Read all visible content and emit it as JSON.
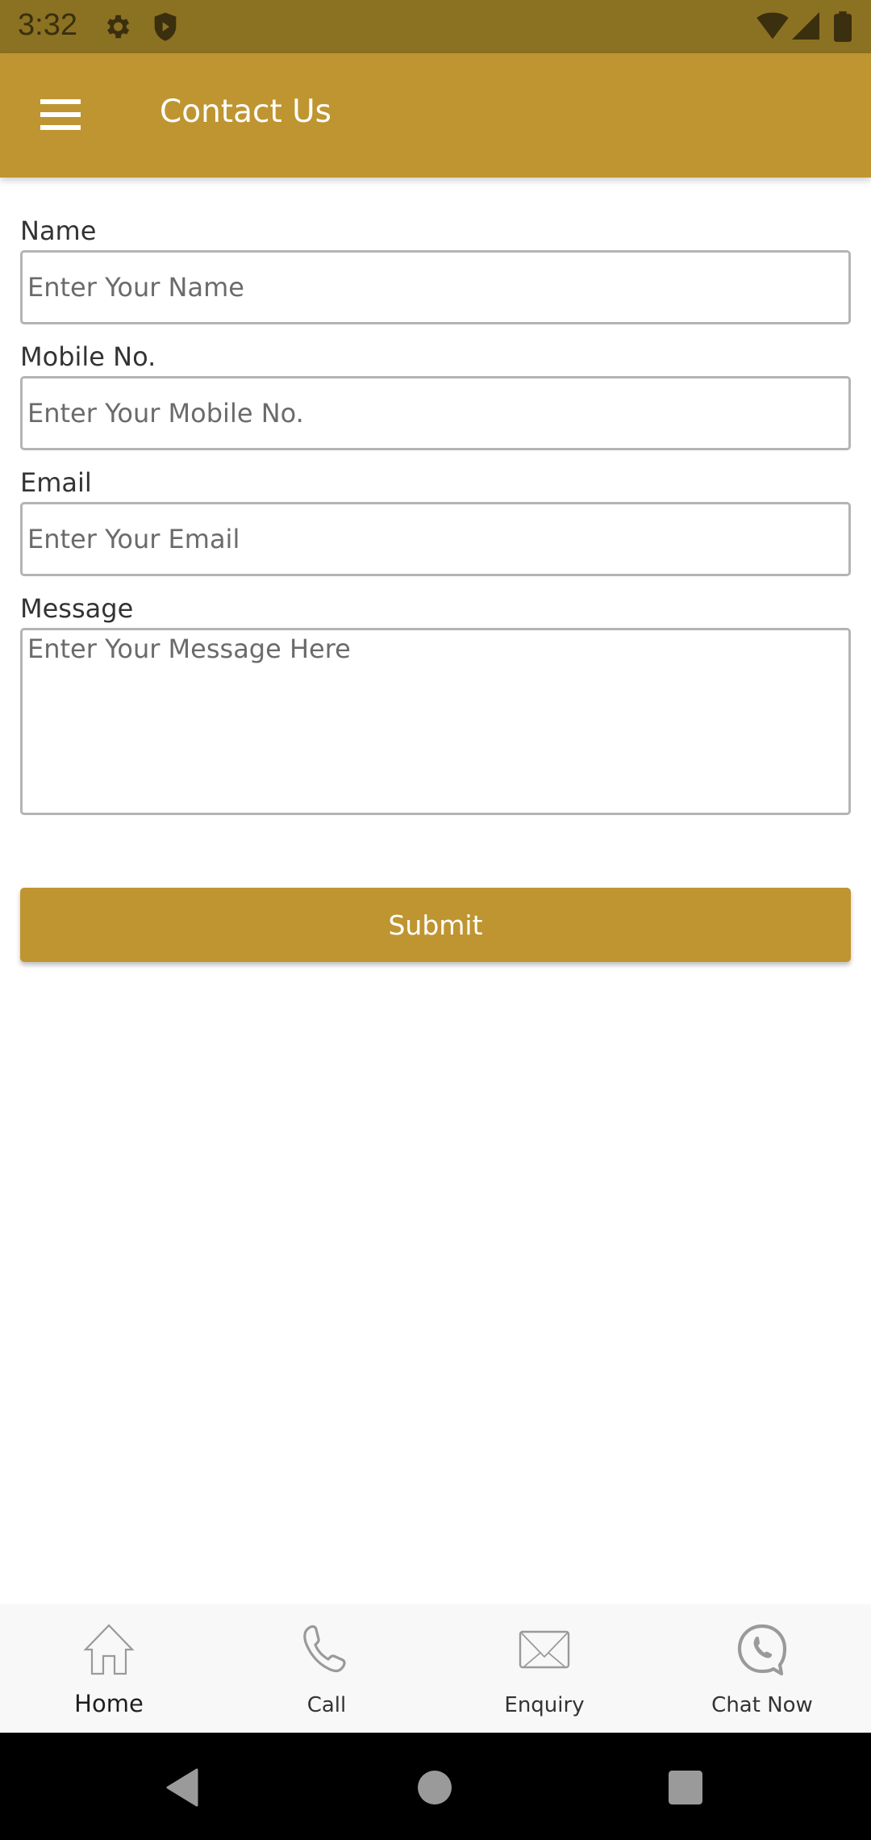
{
  "status_bar": {
    "time": "3:32",
    "icons": [
      "settings-icon",
      "shield-play-icon",
      "wifi-icon",
      "signal-icon",
      "battery-icon"
    ]
  },
  "app_bar": {
    "title": "Contact Us",
    "menu_icon": "hamburger-menu-icon"
  },
  "form": {
    "fields": [
      {
        "label": "Name",
        "placeholder": "Enter Your Name",
        "value": ""
      },
      {
        "label": "Mobile No.",
        "placeholder": "Enter Your Mobile No.",
        "value": ""
      },
      {
        "label": "Email",
        "placeholder": "Enter Your Email",
        "value": ""
      },
      {
        "label": "Message",
        "placeholder": "Enter Your Message Here",
        "value": ""
      }
    ],
    "submit_label": "Submit"
  },
  "bottom_nav": {
    "items": [
      {
        "label": "Home",
        "icon": "home-icon",
        "active": true
      },
      {
        "label": "Call",
        "icon": "phone-icon",
        "active": false
      },
      {
        "label": "Enquiry",
        "icon": "envelope-icon",
        "active": false
      },
      {
        "label": "Chat Now",
        "icon": "whatsapp-chat-icon",
        "active": false
      }
    ]
  },
  "system_nav": {
    "buttons": [
      "back-icon",
      "home-circle-icon",
      "recents-icon"
    ]
  },
  "colors": {
    "accent": "#bf9531",
    "status_bar": "#8b7122",
    "field_border": "#b4b4b4",
    "nav_background": "#f8f8f8"
  }
}
